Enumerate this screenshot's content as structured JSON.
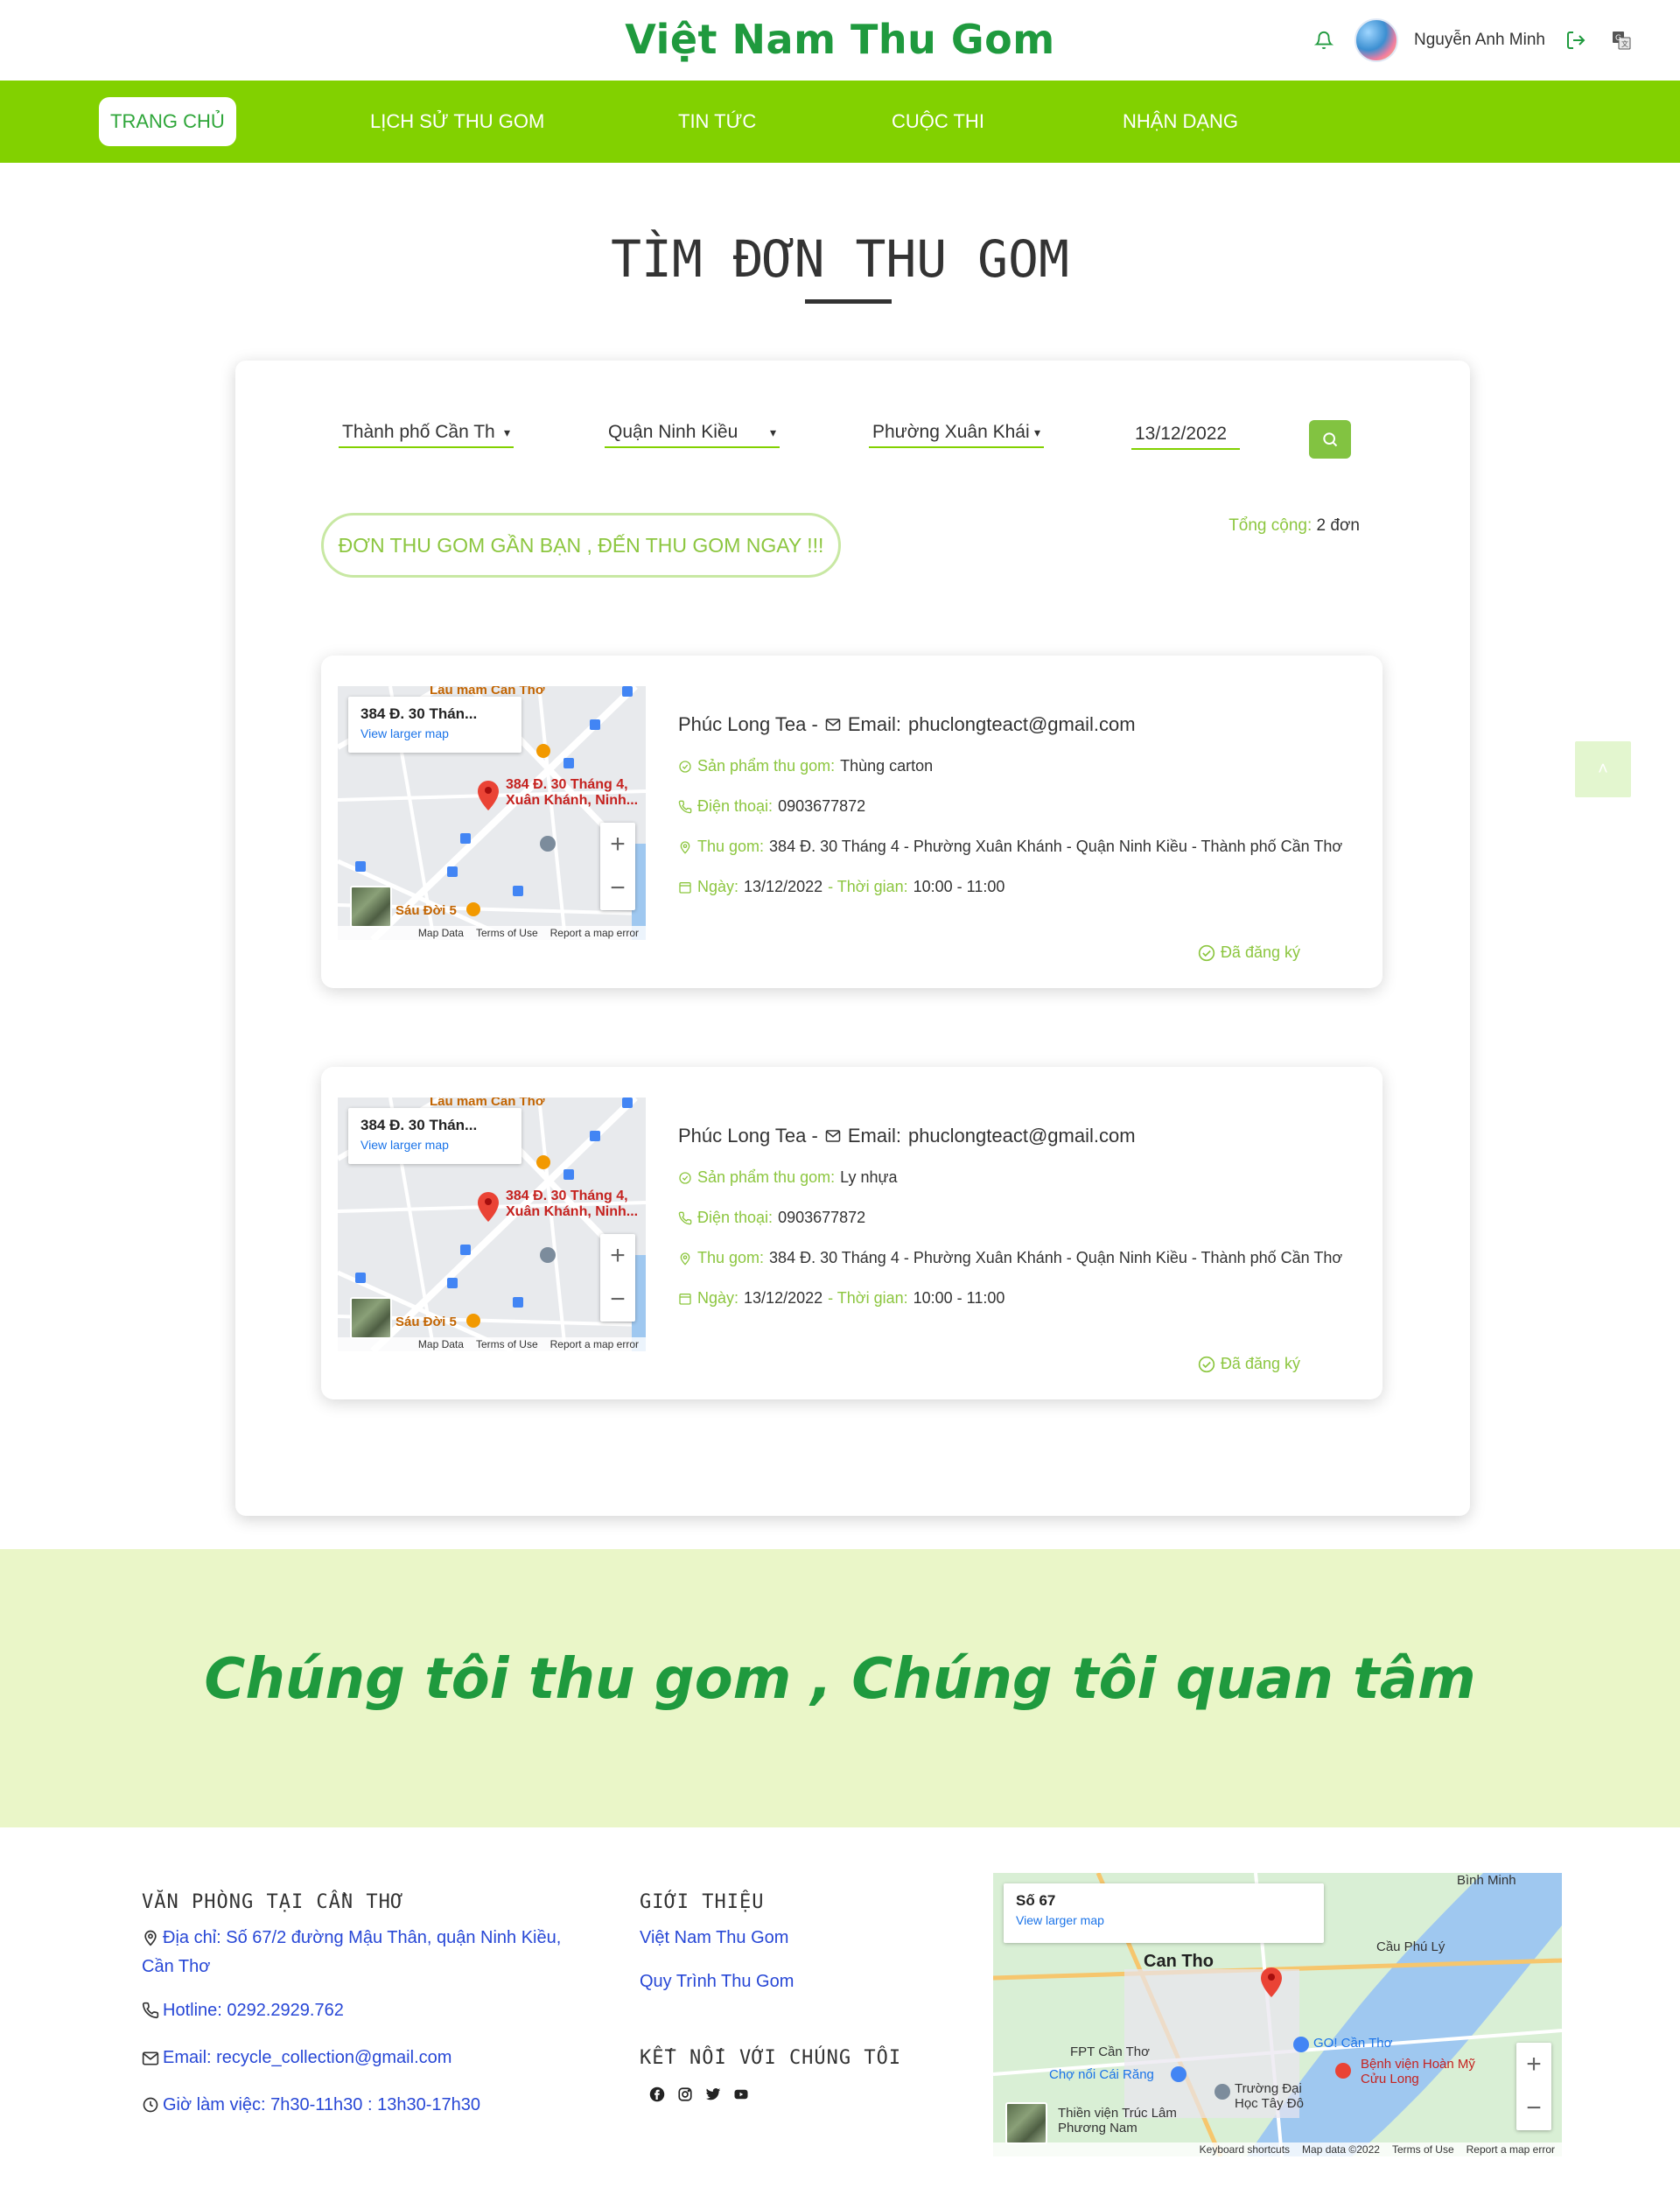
{
  "header": {
    "brand": "Việt Nam Thu Gom",
    "user_name": "Nguyễn Anh Minh"
  },
  "nav": {
    "items": [
      {
        "label": "TRANG CHỦ",
        "active": true
      },
      {
        "label": "LỊCH SỬ THU GOM",
        "active": false
      },
      {
        "label": "TIN TỨC",
        "active": false
      },
      {
        "label": "CUỘC THI",
        "active": false
      },
      {
        "label": "NHẬN DẠNG",
        "active": false
      }
    ]
  },
  "main": {
    "title": "TÌM ĐƠN THU GOM",
    "filters": {
      "city": "Thành phố Cần Th",
      "district": "Quận Ninh Kiều",
      "ward": "Phường Xuân Khái",
      "date": "13/12/2022"
    },
    "promo": "ĐƠN THU GOM GẦN BẠN , ĐẾN THU GOM NGAY !!!",
    "total_label": "Tổng cộng:",
    "total_value": "2 đơn",
    "orders": [
      {
        "map_address": "384 Đ. 30 Thán...",
        "map_larger": "View larger map",
        "map_label_1": "384 Đ. 30 Tháng 4,",
        "map_label_2": "Xuân Khánh, Ninh...",
        "map_poi_1": "Lẩu mắm Cần Thơ",
        "map_poi_2": "Sáu Đời 5",
        "map_footer": [
          "Map Data",
          "Terms of Use",
          "Report a map error"
        ],
        "shop": "Phúc Long Tea -",
        "email_label": "Email:",
        "email": "phuclongteact@gmail.com",
        "product_label": "Sản phẩm thu gom:",
        "product": "Thùng carton",
        "phone_label": "Điện thoại:",
        "phone": "0903677872",
        "address_label": "Thu gom:",
        "address": "384 Đ. 30 Tháng 4 - Phường Xuân Khánh - Quận Ninh Kiều - Thành phố Cần Thơ",
        "date_label": "Ngày:",
        "date": "13/12/2022",
        "time_label": "- Thời gian:",
        "time": "10:00 - 11:00",
        "status": "Đã đăng ký"
      },
      {
        "map_address": "384 Đ. 30 Thán...",
        "map_larger": "View larger map",
        "map_label_1": "384 Đ. 30 Tháng 4,",
        "map_label_2": "Xuân Khánh, Ninh...",
        "map_poi_1": "Lẩu mắm Cần Thơ",
        "map_poi_2": "Sáu Đời 5",
        "map_footer": [
          "Map Data",
          "Terms of Use",
          "Report a map error"
        ],
        "shop": "Phúc Long Tea -",
        "email_label": "Email:",
        "email": "phuclongteact@gmail.com",
        "product_label": "Sản phẩm thu gom:",
        "product": "Ly nhựa",
        "phone_label": "Điện thoại:",
        "phone": "0903677872",
        "address_label": "Thu gom:",
        "address": "384 Đ. 30 Tháng 4 - Phường Xuân Khánh - Quận Ninh Kiều - Thành phố Cần Thơ",
        "date_label": "Ngày:",
        "date": "13/12/2022",
        "time_label": "- Thời gian:",
        "time": "10:00 - 11:00",
        "status": "Đã đăng ký"
      }
    ]
  },
  "banner": {
    "text": "Chúng tôi thu gom , Chúng tôi quan tâm"
  },
  "footer": {
    "office_heading": "VĂN PHÒNG TẠI CẦN THƠ",
    "address_line1": "Địa chỉ: Số 67/2 đường Mậu Thân, quận Ninh Kiều,",
    "address_line2": "Cần Thơ",
    "hotline": "Hotline: 0292.2929.762",
    "email": "Email: recycle_collection@gmail.com",
    "hours": "Giờ làm việc: 7h30-11h30 : 13h30-17h30",
    "intro_heading": "GIỚI THIỆU",
    "intro_links": [
      "Việt Nam Thu Gom",
      "Quy Trình Thu Gom"
    ],
    "connect_heading": "KẾT NỐI VỚI CHÚNG TÔI",
    "map_title": "Số 67",
    "map_larger": "View larger map",
    "map_city": "Can Tho",
    "map_labels": [
      "Bình Minh",
      "Cầu Phú Lý",
      "GO! Cần Thơ",
      "Bệnh viện Hoàn Mỹ Cửu Long",
      "Chợ nổi Cái Răng",
      "Trường Đại Học Tây Đô",
      "FPT Cần Thơ",
      "Thiền viện Trúc Lâm Phương Nam"
    ],
    "map_footer": [
      "Keyboard shortcuts",
      "Map data ©2022",
      "Terms of Use",
      "Report a map error"
    ]
  },
  "colors": {
    "brand_green": "#1f9a3e",
    "nav_green": "#82d100",
    "accent_green": "#8cc63f",
    "banner_bg": "#eaf6c8",
    "link_blue": "#2747d6"
  }
}
